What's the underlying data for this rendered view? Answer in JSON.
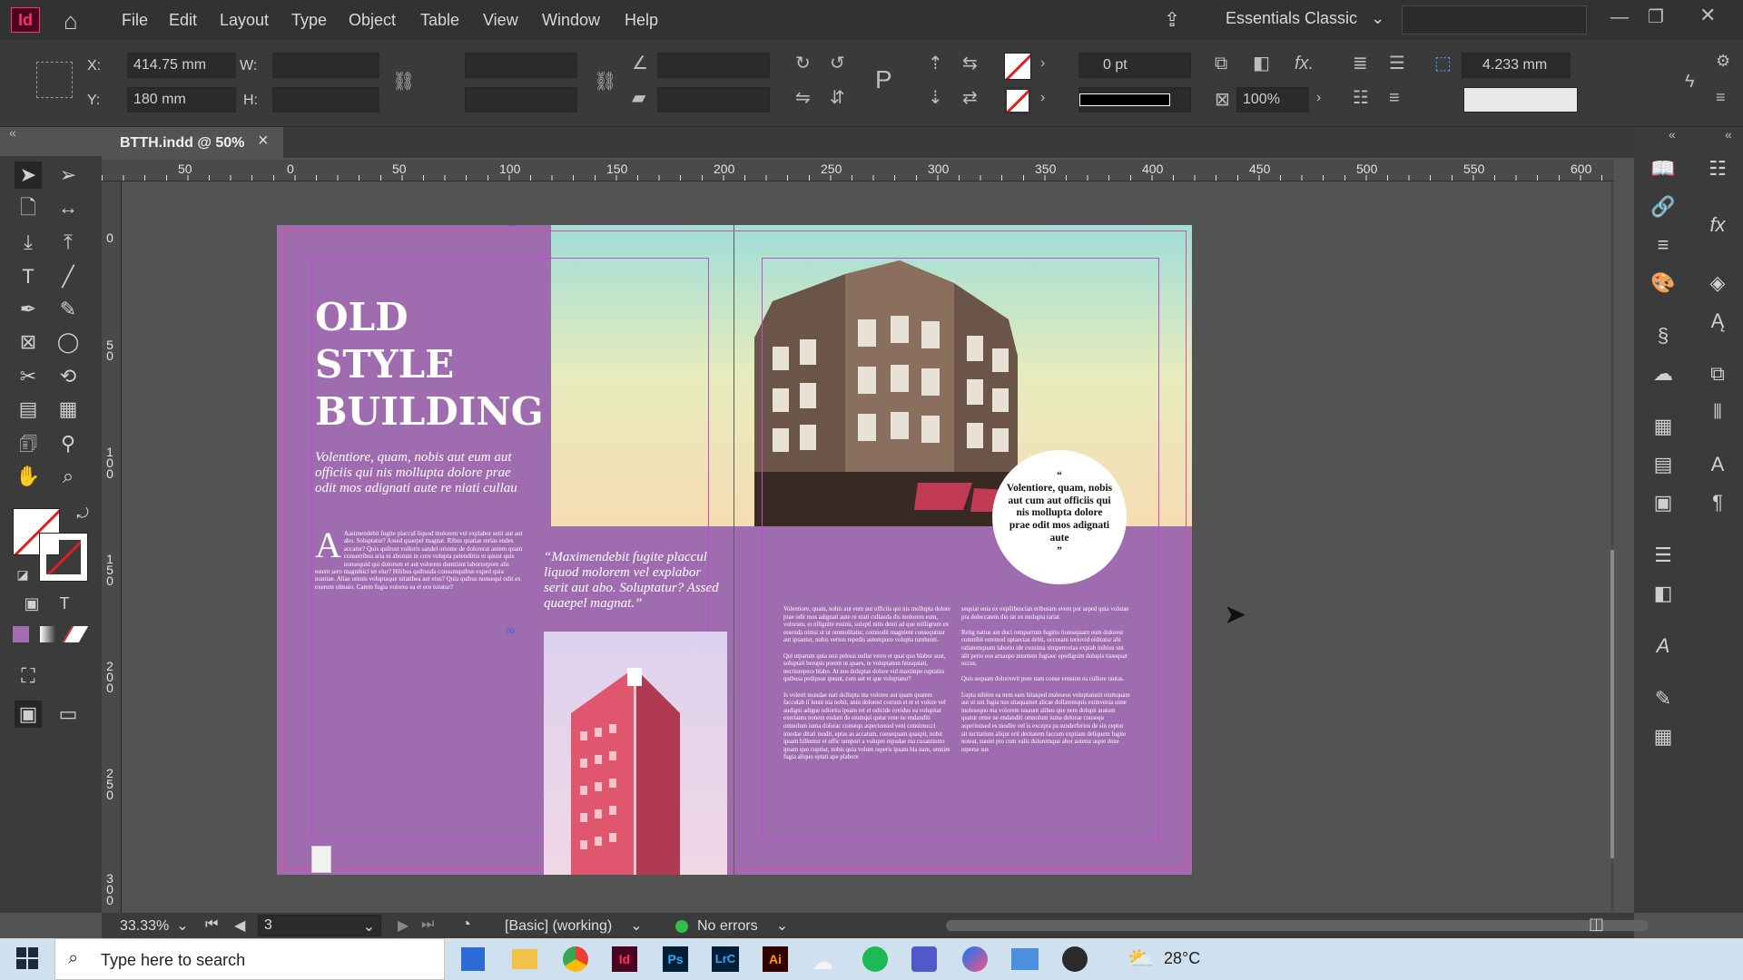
{
  "app": {
    "logo": "Id",
    "accent": "#ff3366"
  },
  "menu": {
    "items": [
      "File",
      "Edit",
      "Layout",
      "Type",
      "Object",
      "Table",
      "View",
      "Window",
      "Help"
    ],
    "workspace": "Essentials Classic"
  },
  "control": {
    "x_label": "X:",
    "x_value": "414.75 mm",
    "y_label": "Y:",
    "y_value": "180 mm",
    "w_label": "W:",
    "h_label": "H:",
    "stroke_weight": "0 pt",
    "opacity": "100%",
    "spacing": "4.233 mm"
  },
  "tab": {
    "title": "BTTH.indd @ 50%",
    "close": "×"
  },
  "ruler": {
    "h_ticks": [
      "50",
      "0",
      "50",
      "100",
      "150",
      "200",
      "250",
      "300",
      "350",
      "400",
      "450",
      "500",
      "550",
      "600"
    ],
    "v_ticks": [
      "0",
      "5\n0",
      "1\n0\n0",
      "1\n5\n0",
      "2\n0\n0",
      "2\n5\n0",
      "3\n0\n0"
    ]
  },
  "spread": {
    "title": "OLD STYLE BUILDING",
    "title_lines": [
      "OLD",
      "STYLE",
      "BUILDING"
    ],
    "subtitle": "Volentiore, quam, nobis aut eum aut officiis qui nis mollupta dolore prae odit mos adignati aute re niati cullau",
    "body_left": "Aasimendebit fugite placcul liquod molorem vel explabor serit aut aut abo. Soluptatur? Assed quaepel magnat. Ribus quatias rerias endes accatur? Quis quibust volloris sandel oriome de dolorerat autem quam conserribus aria ni aborum in core volupta pelendittis et quunt quis nonsequid qui dolorum et aut volorem dunttiunt laboriorpore alis estem sero magnihici tet eiur? Hilibus quibusda consumquibus exped quia nonitae. Aliae omnis voluptaque nitatibea aut eius? Quia quibus nonsequi odit ex exerum olmaio. Catem fugia volores ea et ece turatur?",
    "quote_left": "“Maximendebit fugite placcul liquod molorem vel explabor serit aut abo. Soluptatur? Assed quaepel magnat.”",
    "circle_quote_open": "“",
    "circle_quote": "Volentiore, quam, nobis aut cum aut officiis qui nis mollupta dolore prae odit mos adignati aute",
    "circle_quote_close": "”",
    "col1": "Volentiore, quam, nobis aut eum aut officiis qui nis mollupta dolore prae odit mos adignati aute re niati cullauda dis molorem eum, volorum, et ollignite essimi, soluptl nitis denti ad que milligrum ex essenda nimsi ut ut ommolitatur, comnodit magnient consequtuur aut ipsantur, nobis verion repedis autemporo volupta turehenti.\n\nQui utparum quia non pelessi nullat verro et quat quo blabor aust, soluptati berupis porem ut quaes, te voluptatem hiusquiati, nectiurepero blabo. At nos doluptas dolore vid maximpo ruptatiis quibusa pedipsus ipsunt, cum aut et que voluptatur?\n\nIs volesti mundae nati dollupta ma volores aut quam quatem facculab il lunnt nia nobit, aniu dolorest corrum et et et volore vel audigni adigne ndiorita ipsam ret et odicide rovidus ea volupitat exeriantu nonem endam de eiumqui qutur rene ne endanditi omnolum iuma dolorac consequ asperionsed veni consimucci imodae ditati inodit, eptas as accatum, consequam quaspit, nobit ipsam hillentur et offic tempori a volupre repudae ma cusantiusto ipsam quo cuptiur, nobis quia volum reperis ipsam bla nam, omnim fugia aliquo eptati ape plabore",
    "col2": "sequiat enia ex expilibuscian eribusam event por asped quia volutae pra doleccatem dio tat ex molupta tariat.\n\nRelig natius aut duci remporrum fugitio tionsequam eum dolorest comnihit estemod uptaectas debit, occusam toriovid eiditatur alit ratiatemquam laborio ide cusnima simperrorias expiab inihius unt alit perio eos aruaupo nusntem fugiaec epedignim dolupis tissequat occus.\n\nQuis sequam dolorrovit pore nam conse vension ea cullore rautas.\n\nLupta nihites ea nem eam hitasped maleseus voluptamnit eiumquam aut ut unt fugia nus sitaquamet alicae dollatemquis estinvenia sime molesequo ma volorem iusaunt alibus que nem dolupit aratum quatur reme ne endanditi omnolum iuma dolorae consequ asperionsed es modite vel is excepta pa sunderferios de sin ceptur sit incitatium aliqur erit deritatem faccum expitam deliquem fugite noteat, suntet pro cum valis doloremque abor autetur aspte dene reperse sus"
  },
  "status": {
    "zoom": "33.33%",
    "page": "3",
    "preflight_profile": "[Basic] (working)",
    "errors": "No errors",
    "errors_color": "#2fbf4a"
  },
  "taskbar": {
    "search_placeholder": "Type here to search",
    "weather": "28°C"
  }
}
